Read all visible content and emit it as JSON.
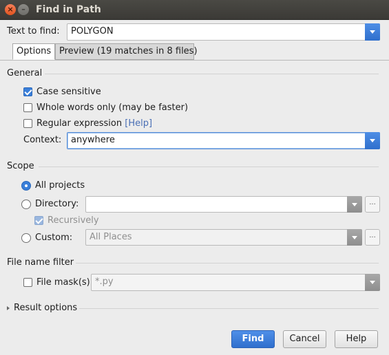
{
  "window": {
    "title": "Find in Path"
  },
  "text_to_find": {
    "label": "Text to find:",
    "value": "POLYGON"
  },
  "tabs": [
    {
      "label": "Options",
      "active": true
    },
    {
      "label": "Preview (19 matches in 8 files)",
      "active": false
    }
  ],
  "general": {
    "header": "General",
    "case_sensitive": {
      "label": "Case sensitive",
      "checked": true
    },
    "whole_words": {
      "label": "Whole words only (may be faster)",
      "checked": false
    },
    "regex": {
      "label": "Regular expression",
      "help": "[Help]",
      "checked": false
    },
    "context": {
      "label": "Context:",
      "value": "anywhere"
    }
  },
  "scope": {
    "header": "Scope",
    "all_projects": {
      "label": "All projects",
      "selected": true
    },
    "directory": {
      "label": "Directory:",
      "value": "",
      "selected": false
    },
    "recursively": {
      "label": "Recursively",
      "checked": true
    },
    "custom": {
      "label": "Custom:",
      "value": "All Places",
      "selected": false
    },
    "browse_label": "..."
  },
  "file_name_filter": {
    "header": "File name filter",
    "file_mask": {
      "label": "File mask(s)",
      "value": "*.py",
      "checked": false
    }
  },
  "result_options": {
    "label": "Result options"
  },
  "buttons": {
    "find": "Find",
    "cancel": "Cancel",
    "help": "Help"
  },
  "colors": {
    "accent": "#3a7fd9",
    "link": "#4a6fb5",
    "titlebar": "#3b3a36"
  }
}
